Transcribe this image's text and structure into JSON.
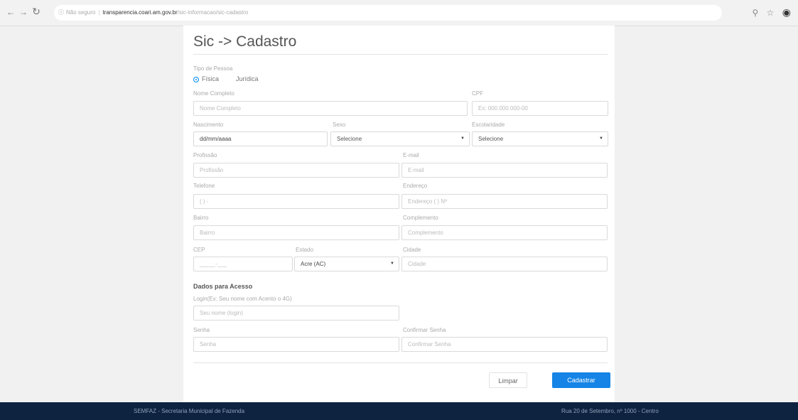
{
  "browser": {
    "url_security": "Não seguro",
    "url_host": "transparencia.coari.am.gov.br",
    "url_path": "/sic-informacao/sic-cadastro"
  },
  "page": {
    "title": "Sic -> Cadastro",
    "person_type_label": "Tipo de Pessoa",
    "radio_fisica": "Física",
    "radio_juridica": "Jurídica"
  },
  "form": {
    "nome_label": "Nome Completo",
    "nome_placeholder": "Nome Completo",
    "cpf_label": "CPF",
    "cpf_placeholder": "Ex: 000.000.000-00",
    "nascimento_label": "Nascimento",
    "nascimento_value": "dd/mm/aaaa",
    "sexo_label": "Sexo",
    "sexo_value": "Selecione",
    "escolaridade_label": "Escolaridade",
    "escolaridade_value": "Selecione",
    "profissao_label": "Profissão",
    "profissao_placeholder": "Profissão",
    "email_label": "E-mail",
    "email_placeholder": "E-mail",
    "telefone_label": "Telefone",
    "telefone_placeholder": "(  )         -",
    "endereco_label": "Endereço",
    "endereco_placeholder": "Endereço (        )    Nº",
    "bairro_label": "Bairro",
    "bairro_placeholder": "Bairro",
    "complemento_label": "Complemento",
    "complemento_placeholder": "Complemento",
    "cep_label": "CEP",
    "cep_placeholder": "_____-___",
    "estado_label": "Estado",
    "estado_value": "Acre (AC)",
    "cidade_label": "Cidade",
    "cidade_placeholder": "Cidade",
    "section_access": "Dados para Acesso",
    "login_label": "Login(Ex: Seu nome com Acento o 4G)",
    "login_placeholder": "Seu nome (login)",
    "senha_label": "Senha",
    "senha_placeholder": "Senha",
    "confirmar_label": "Confirmar Senha",
    "confirmar_placeholder": "Confirmar Senha"
  },
  "buttons": {
    "clear": "Limpar",
    "submit": "Cadastrar"
  },
  "footer": {
    "left": "SEMFAZ - Secretaria Municipal de Fazenda",
    "right": "Rua 20 de Setembro, nº 1000 - Centro"
  },
  "colors": {
    "primary": "#1584e6",
    "footer_bg": "#0e2340"
  }
}
